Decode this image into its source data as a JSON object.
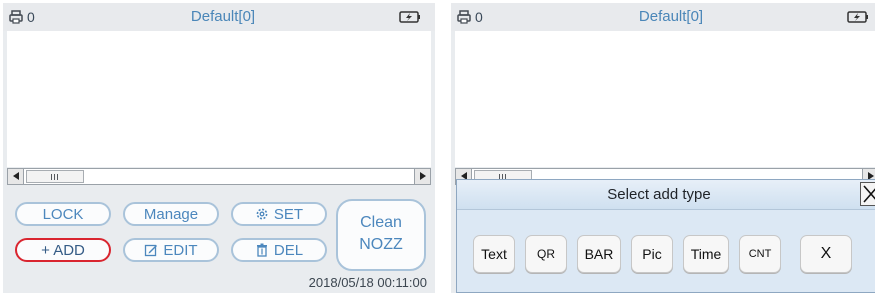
{
  "left_screen": {
    "status": {
      "printer_count": "0",
      "template_name": "Default[0]",
      "printer_icon": "printer-icon",
      "battery_icon": "battery-charging-icon"
    },
    "buttons": {
      "lock": "LOCK",
      "manage": "Manage",
      "set": "SET",
      "add": "+ ADD",
      "edit": "EDIT",
      "del": "DEL",
      "clean_line1": "Clean",
      "clean_line2": "NOZZ"
    },
    "icons": {
      "set": "gear-icon",
      "edit": "edit-icon",
      "del": "trash-icon"
    },
    "datetime": "2018/05/18 00:11:00",
    "highlight_color": "#d9252f"
  },
  "right_screen": {
    "status": {
      "printer_count": "0",
      "template_name": "Default[0]"
    },
    "dialog": {
      "title": "Select add type",
      "close_label": "X",
      "options": [
        "Text",
        "QR",
        "BAR",
        "Pic",
        "Time",
        "CNT",
        "X"
      ]
    }
  },
  "colors": {
    "accent": "#4c87bd",
    "title": "#4a86b8",
    "border": "#a9c3da",
    "dialog_bg": "#dce8f4"
  }
}
